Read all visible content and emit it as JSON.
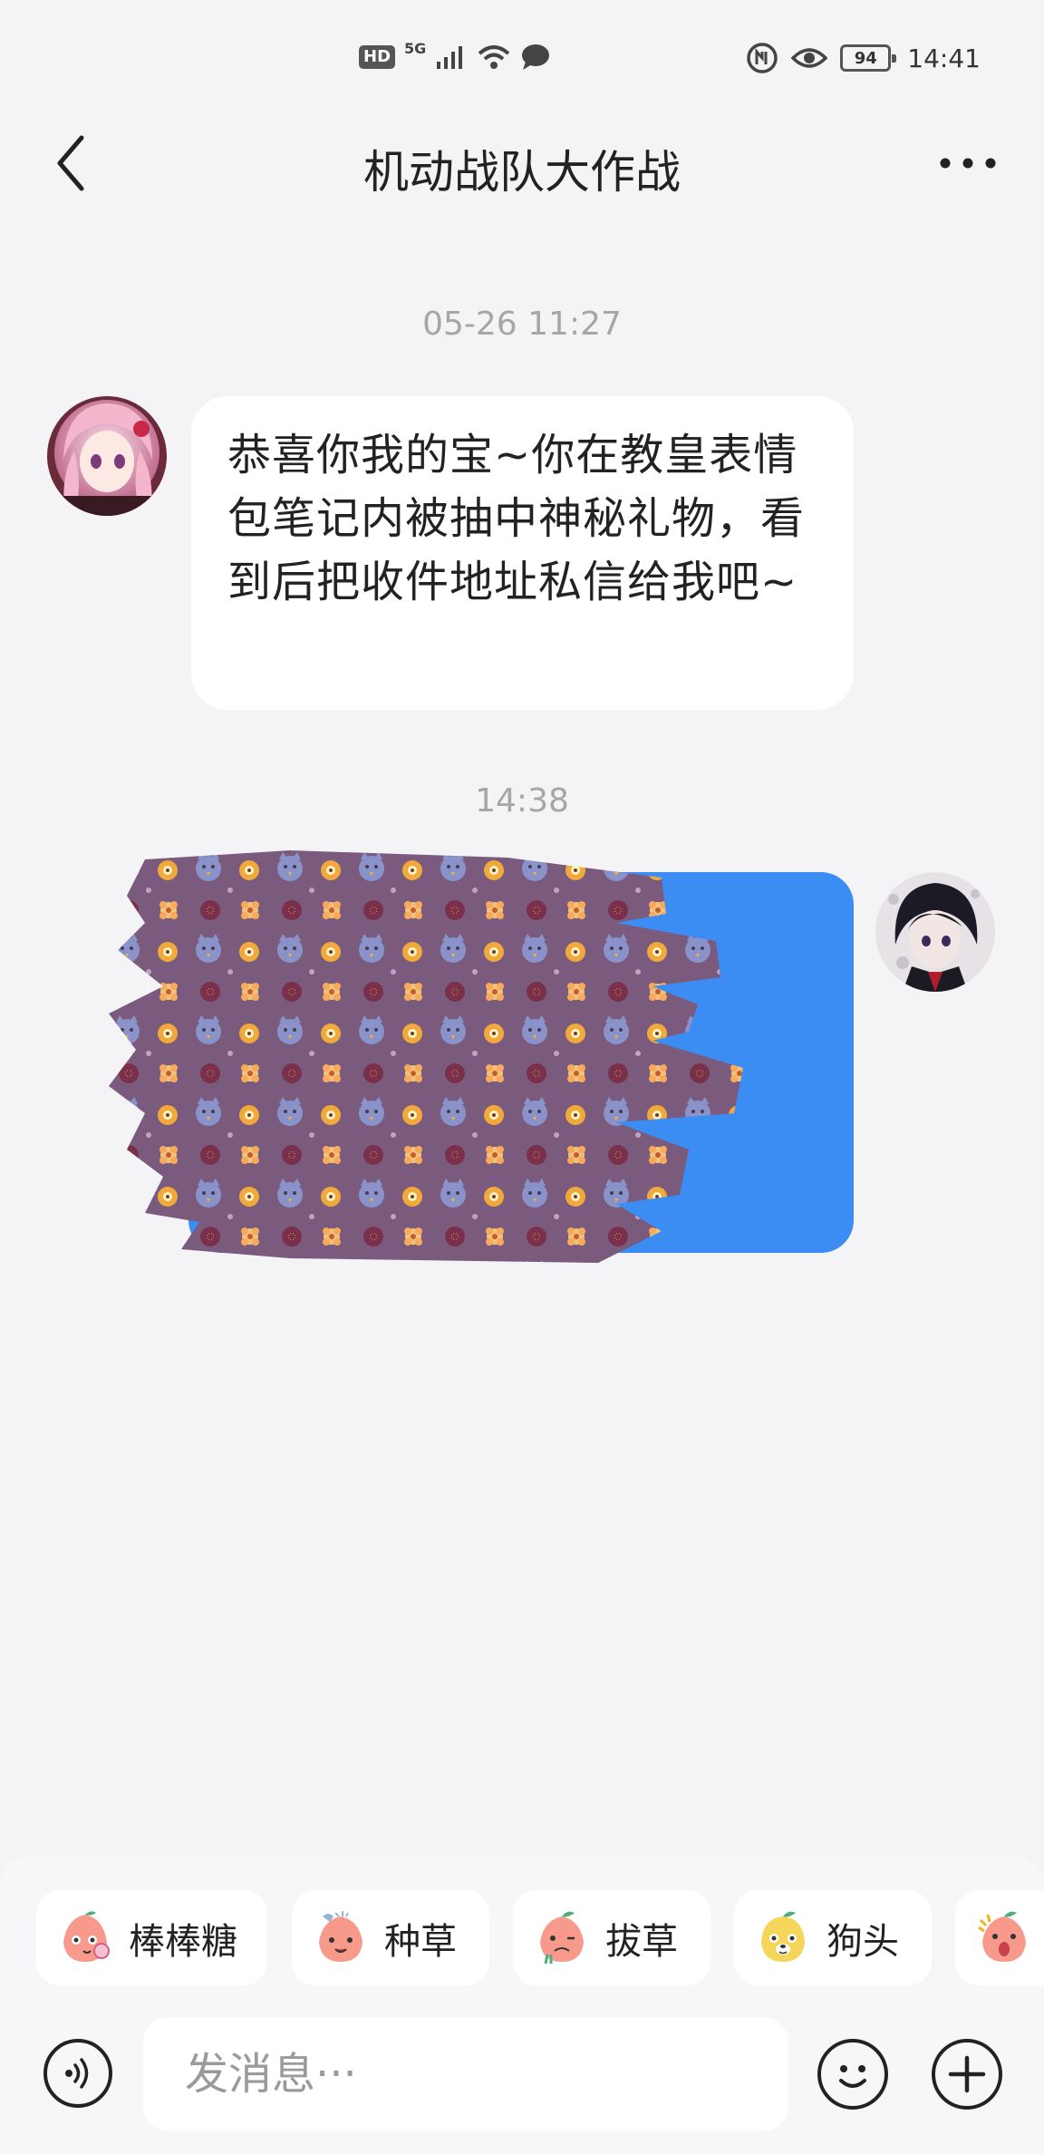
{
  "status_bar": {
    "hd_label": "HD",
    "network_label": "5G",
    "battery_level": "94",
    "time": "14:41",
    "icons": [
      "hd-icon",
      "signal-icon",
      "wifi-icon",
      "chat-notification-icon",
      "nfc-icon",
      "eye-care-icon",
      "battery-icon"
    ]
  },
  "header": {
    "title": "机动战队大作战",
    "back_icon": "chevron-left-icon",
    "more_icon": "more-dots-icon"
  },
  "messages": [
    {
      "timestamp": "05-26 11:27",
      "direction": "incoming",
      "avatar": "pink-haired-anime-girl-avatar",
      "text": "恭喜你我的宝~你在教皇表情包笔记内被抽中神秘礼物，看到后把收件地址私信给我吧~"
    },
    {
      "timestamp": "14:38",
      "direction": "outgoing",
      "avatar": "dark-haired-anime-boy-avatar",
      "content": "redacted-image-message",
      "bubble_color": "#3b8df3"
    }
  ],
  "quick_reactions": [
    {
      "label": "棒棒糖",
      "icon": "lollipop-peach-icon"
    },
    {
      "label": "种草",
      "icon": "plant-peach-icon"
    },
    {
      "label": "拔草",
      "icon": "pull-grass-peach-icon"
    },
    {
      "label": "狗头",
      "icon": "dog-head-icon"
    },
    {
      "label": "",
      "icon": "surprised-peach-icon"
    }
  ],
  "input": {
    "placeholder": "发消息···",
    "value": "",
    "voice_icon": "voice-icon",
    "emoji_icon": "emoji-icon",
    "plus_icon": "plus-icon"
  },
  "colors": {
    "background": "#f4f4f6",
    "bubble_in": "#ffffff",
    "bubble_out": "#3b8df3",
    "scribble": "#7a5b7e",
    "timestamp": "#a6a6a8"
  }
}
